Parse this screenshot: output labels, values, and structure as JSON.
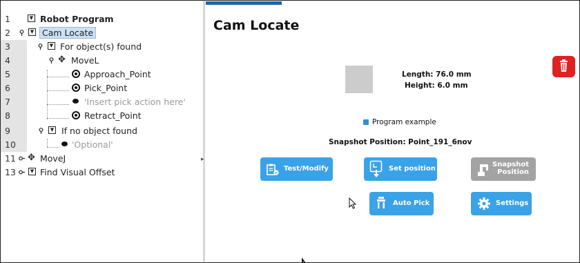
{
  "tree": {
    "rows": [
      {
        "num": "1",
        "label": "Robot Program"
      },
      {
        "num": "2",
        "label": "Cam Locate"
      },
      {
        "num": "3",
        "label": "For object(s) found"
      },
      {
        "num": "4",
        "label": "MoveL"
      },
      {
        "num": "5",
        "label": "Approach_Point"
      },
      {
        "num": "6",
        "label": "Pick_Point"
      },
      {
        "num": "7",
        "label": "'Insert pick action here'"
      },
      {
        "num": "8",
        "label": "Retract_Point"
      },
      {
        "num": "9",
        "label": "If no object found"
      },
      {
        "num": "10",
        "label": "'Optional'"
      },
      {
        "num": "11",
        "label": "MoveJ"
      },
      {
        "num": "13",
        "label": "Find Visual Offset"
      }
    ]
  },
  "panel": {
    "title": "Cam Locate",
    "length_text": "Length: 76.0 mm",
    "height_text": "Height: 6.0 mm",
    "program_example": "Program example",
    "snapshot_position": "Snapshot Position: Point_191_6nov"
  },
  "buttons": {
    "test_modify": "Test/Modify",
    "set_position": "Set position",
    "snapshot_line1": "Snapshot",
    "snapshot_line2": "Position",
    "auto_pick": "Auto Pick",
    "settings": "Settings"
  },
  "colors": {
    "button_blue": "#3aa2e6",
    "button_disabled": "#a3a3a3",
    "delete_red": "#dd2222",
    "selection": "#cfe0f3"
  }
}
